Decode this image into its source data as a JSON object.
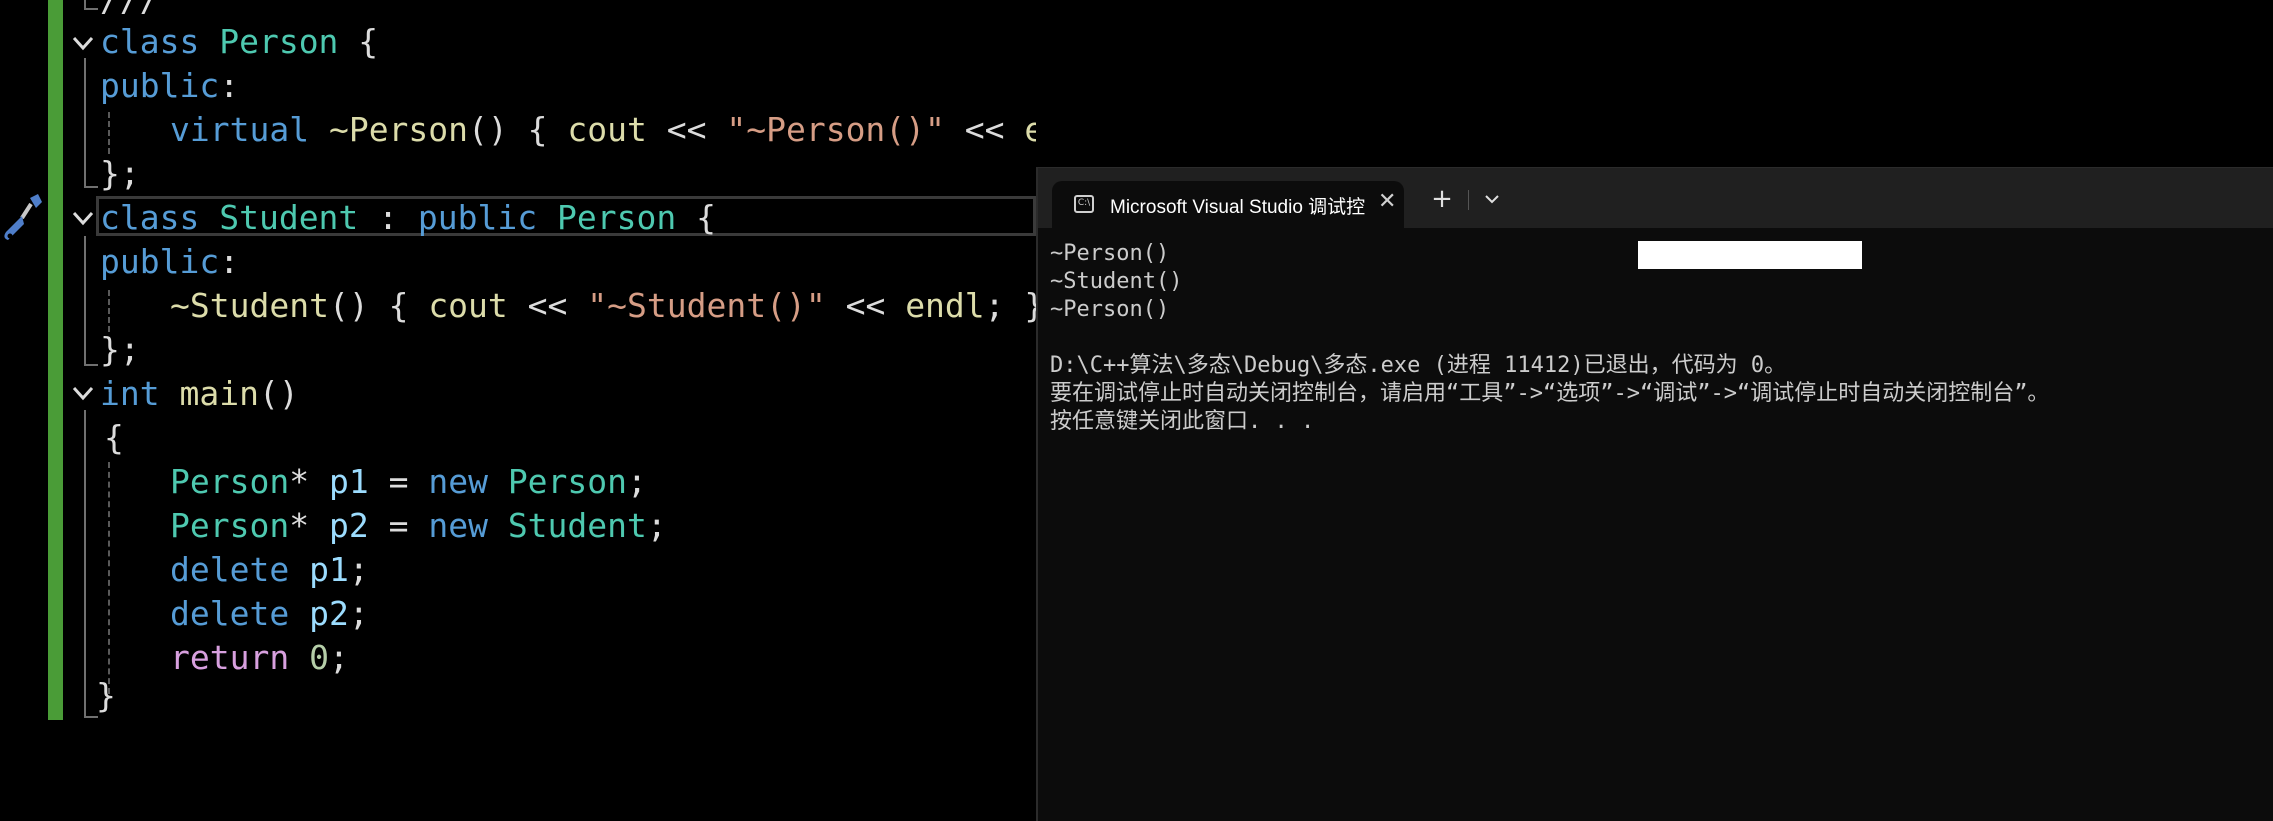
{
  "editor": {
    "top_fragment": "///",
    "lines": {
      "l1_kw": "class",
      "l1_name": "Person",
      "l1_brace": " {",
      "l2_kw": "public",
      "l2_colon": ":",
      "l3_kw": "virtual",
      "l3_fn": "~Person",
      "l3_parens": "()",
      "l3_open": " { ",
      "l3_cout": "cout",
      "l3_op1": " << ",
      "l3_str": "\"~Person()\"",
      "l3_op2": " << ",
      "l3_endl": "endl",
      "l3_close": "; }",
      "l4": "};",
      "l5_kw": "class",
      "l5_name": "Student",
      "l5_colon": " : ",
      "l5_pub": "public",
      "l5_base": "Person",
      "l5_brace": " {",
      "l6_kw": "public",
      "l6_colon": ":",
      "l7_fn": "~Student",
      "l7_parens": "()",
      "l7_open": " { ",
      "l7_cout": "cout",
      "l7_op1": " << ",
      "l7_str": "\"~Student()\"",
      "l7_op2": " << ",
      "l7_endl": "endl",
      "l7_close": "; }",
      "l8": "};",
      "l9_kw": "int",
      "l9_fn": "main",
      "l9_parens": "()",
      "l10": "{",
      "l11_type": "Person",
      "l11_star": "* ",
      "l11_var": "p1",
      "l11_eq": " = ",
      "l11_new": "new",
      "l11_sp": " ",
      "l11_cls": "Person",
      "l11_semi": ";",
      "l12_type": "Person",
      "l12_star": "* ",
      "l12_var": "p2",
      "l12_eq": " = ",
      "l12_new": "new",
      "l12_sp": " ",
      "l12_cls": "Student",
      "l12_semi": ";",
      "l13_kw": "delete",
      "l13_sp": " ",
      "l13_var": "p1",
      "l13_semi": ";",
      "l14_kw": "delete",
      "l14_sp": " ",
      "l14_var": "p2",
      "l14_semi": ";",
      "l15_kw": "return",
      "l15_sp": " ",
      "l15_num": "0",
      "l15_semi": ";",
      "l16": "}"
    }
  },
  "terminal": {
    "tab_title": "Microsoft Visual Studio 调试控",
    "tab_icon_text": "C:\\",
    "close_glyph": "✕",
    "plus_glyph": "+",
    "output": [
      "~Person()",
      "~Student()",
      "~Person()",
      "",
      "D:\\C++算法\\多态\\Debug\\多态.exe (进程 11412)已退出，代码为 0。",
      "要在调试停止时自动关闭控制台，请启用“工具”->“选项”->“调试”->“调试停止时自动关闭控制台”。",
      "按任意键关闭此窗口. . ."
    ]
  },
  "colors": {
    "keyword": "#569cd6",
    "type": "#4ec9b0",
    "function": "#dcdcaa",
    "string": "#d69d85",
    "variable": "#9cdcfe",
    "control": "#d8a0df",
    "change_bar": "#4a9c37"
  }
}
